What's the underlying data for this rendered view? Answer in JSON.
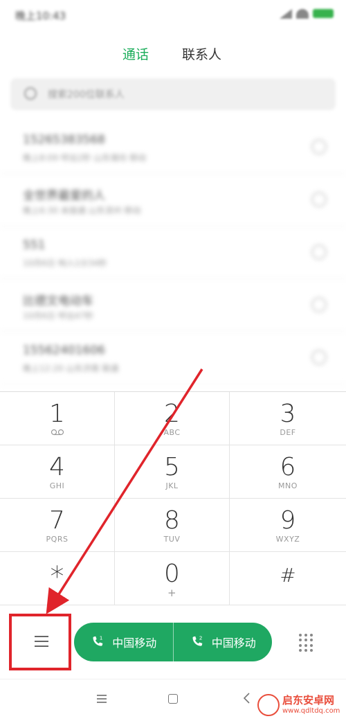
{
  "status_bar": {
    "time": "晚上10:43"
  },
  "tabs": [
    {
      "label": "通话",
      "active": true
    },
    {
      "label": "联系人",
      "active": false
    }
  ],
  "search": {
    "placeholder": "搜索200位联系人"
  },
  "call_log": [
    {
      "name": "15265383568",
      "detail": "晚上8:09 呼出2秒 山东潍坊 移动"
    },
    {
      "name": "全世界最爱的人",
      "detail": "晚上6:30 未接通 山东滨州 移动"
    },
    {
      "name": "551",
      "detail": "10月6日 响入1分34秒"
    },
    {
      "name": "比德文电动车",
      "detail": "10月6日 呼出47秒"
    },
    {
      "name": "15562401606",
      "detail": "晚上12:20 山东济南 联通"
    }
  ],
  "dialpad": {
    "keys": [
      {
        "digit": "1",
        "letters": "",
        "voicemail": true
      },
      {
        "digit": "2",
        "letters": "ABC"
      },
      {
        "digit": "3",
        "letters": "DEF"
      },
      {
        "digit": "4",
        "letters": "GHI"
      },
      {
        "digit": "5",
        "letters": "JKL"
      },
      {
        "digit": "6",
        "letters": "MNO"
      },
      {
        "digit": "7",
        "letters": "PQRS"
      },
      {
        "digit": "8",
        "letters": "TUV"
      },
      {
        "digit": "9",
        "letters": "WXYZ"
      },
      {
        "digit": "*",
        "letters": ""
      },
      {
        "digit": "0",
        "letters": "+"
      },
      {
        "digit": "#",
        "letters": ""
      }
    ]
  },
  "call_buttons": {
    "sim1": {
      "label": "中国移动",
      "sim": "1"
    },
    "sim2": {
      "label": "中国移动",
      "sim": "2"
    }
  },
  "watermark": {
    "title": "启东安卓网",
    "url": "www.qdltdq.com"
  },
  "colors": {
    "accent": "#1fa862",
    "highlight": "#e0242b",
    "watermark": "#e94e3c"
  },
  "icons": [
    "menu-icon",
    "phone-icon",
    "keypad-icon",
    "search-icon",
    "info-icon",
    "voicemail-icon",
    "home-icon",
    "back-icon"
  ]
}
